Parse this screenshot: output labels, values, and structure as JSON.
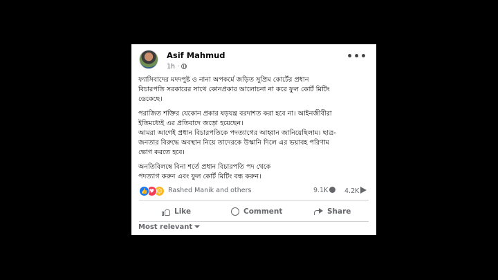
{
  "post": {
    "author": "Asif Mahmud",
    "time": "1h",
    "more": "•••",
    "paragraphs": [
      "ফ্যাসিবাদের মদদপুষ্ট ও নানা অপকর্মে জড়িত সুপ্রিম কোর্টের প্রধান\nবিচারপতি সরকারের সাথে কোনপ্রকার আলোচনা না করে ফুল কোর্ট মিটিং\nডেকেছে।",
      "পরাজিত শক্তির যেকোন প্রকার ষড়যন্ত্র বরদাশত করা হবে না। আইনজীবীরা\nইতিমধ্যেই এর প্রতিবাদে জড়ো হয়েছেন।\nআমরা আগেই প্রধান বিচারপতিকে পদত্যাগের আহ্বান জানিয়েছিলাম। ছাত্র-\nজনতার বিরুদ্ধে অবস্থান নিয়ে তাদেরকে উস্কানি দিলে এর ভয়াবহ পরিণাম\nভোগ করতে হবে।",
      "অনতিবিলম্বে বিনা শর্তে প্রধান বিচারপতি পদ থেকে\nপদত্যাগ করুন এবং ফুল কোর্ট মিটিং বন্ধ করুন।"
    ]
  },
  "reactions": {
    "icons": [
      "like-reaction",
      "love-reaction",
      "care-reaction"
    ],
    "names": "Rashed Manik and others",
    "comments_count": "9.1K",
    "shares_count": "4.2K"
  },
  "actions": {
    "like": "Like",
    "comment": "Comment",
    "share": "Share"
  },
  "sort": {
    "label": "Most relevant"
  },
  "colors": {
    "background": "#000000",
    "card": "#ffffff",
    "secondary_text": "#65676b",
    "like_blue": "#1877f2",
    "love_red": "#f33e58"
  }
}
